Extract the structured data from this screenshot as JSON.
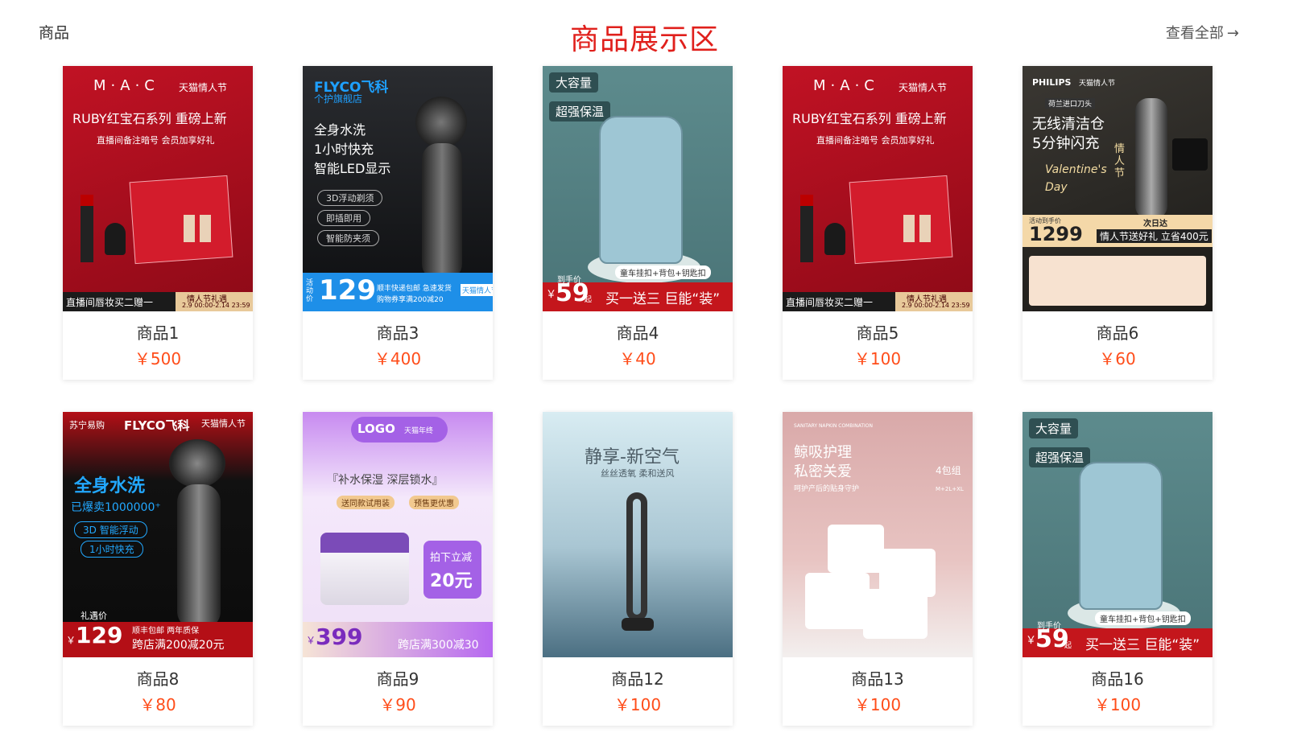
{
  "header": {
    "section_label": "商品",
    "title": "商品展示区",
    "view_all": "查看全部",
    "view_all_arrow": "→"
  },
  "products": [
    {
      "name": "商品1",
      "price": "￥500"
    },
    {
      "name": "商品3",
      "price": "￥400"
    },
    {
      "name": "商品4",
      "price": "￥40"
    },
    {
      "name": "商品5",
      "price": "￥100"
    },
    {
      "name": "商品6",
      "price": "￥60"
    },
    {
      "name": "商品8",
      "price": "￥80"
    },
    {
      "name": "商品9",
      "price": "￥90"
    },
    {
      "name": "商品12",
      "price": "￥100"
    },
    {
      "name": "商品13",
      "price": "￥100"
    },
    {
      "name": "商品16",
      "price": "￥100"
    }
  ],
  "images": {
    "mac": {
      "brand": "M·A·C",
      "fest": "天猫情人节",
      "headline": "RUBY红宝石系列 重磅上新",
      "sub": "直播间备注暗号  会员加享好礼",
      "bottom": "直播间唇妆买二赠一",
      "tag": "情人节礼遇",
      "date": "2.9 00:00-2.14 23:59"
    },
    "flyco": {
      "brand": "FLYCO飞科",
      "store": "个护旗舰店",
      "l1": "全身水洗",
      "l2": "1小时快充",
      "l3": "智能LED显示",
      "p1": "3D浮动剃须",
      "p2": "即插即用",
      "p3": "智能防夹须",
      "price": "129",
      "price_prefix": "活动价",
      "note1": "顺丰快递包邮  急速发货",
      "note2": "购物券享满200减20",
      "badge": "天猫情人节"
    },
    "bag": {
      "tag1": "大容量",
      "tag2": "超强保温",
      "hand_label": "到手价",
      "price": "59",
      "unit": "起",
      "offer": "买一送三 巨能“装”",
      "gift": "童车挂扣+背包+钥匙扣"
    },
    "philips": {
      "brand": "PHILIPS",
      "fest": "天猫情人节",
      "origin": "荷兰进口刀头",
      "l1": "无线清洁仓",
      "l2": "5分钟闪充",
      "script": "Valentine's Day",
      "label": "情人节",
      "delivery": "次日达",
      "price_label": "活动到手价",
      "price": "1299",
      "gift": "情人节送好礼 立省400元"
    },
    "flyco2": {
      "partner": "苏宁易购",
      "brand": "FLYCO飞科",
      "fest": "天猫情人节",
      "l1": "全身水洗",
      "l2": "已爆卖1000000⁺",
      "p1": "3D 智能浮动",
      "p2": "1小时快充",
      "price_label": "礼遇价",
      "price": "129",
      "note": "顺丰包邮  两年质保",
      "promo": "跨店满200减20元"
    },
    "logo": {
      "logo": "LOGO",
      "fest": "天猫年终",
      "headline": "『补水保湿  深层锁水』",
      "b1": "送同款试用装",
      "b2": "预售更优惠",
      "promo1": "拍下立减",
      "promo2": "20元",
      "price": "399",
      "promo": "跨店满300减30"
    },
    "fan": {
      "l1": "静享-新空气",
      "l2": "丝丝透氧  柔和送风"
    },
    "pad": {
      "top": "SANITARY NAPKIN COMBINATION",
      "l1": "鲸吸护理",
      "l2": "私密关爱",
      "count": "4包组",
      "sub": "呵护产后的贴身守护",
      "sizes": "M+2L+XL"
    }
  }
}
